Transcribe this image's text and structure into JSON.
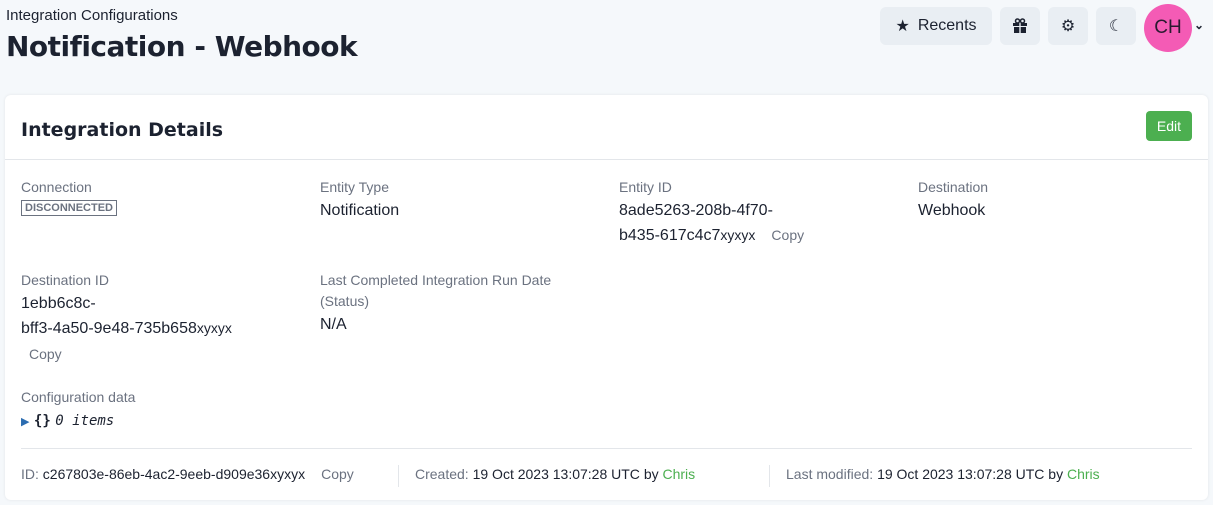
{
  "header": {
    "breadcrumb": "Integration Configurations",
    "title": "Notification - Webhook",
    "recents": "Recents",
    "avatar": "CH"
  },
  "card": {
    "title": "Integration Details",
    "edit": "Edit",
    "connection": {
      "label": "Connection",
      "value": "DISCONNECTED"
    },
    "entity_type": {
      "label": "Entity Type",
      "value": "Notification"
    },
    "entity_id": {
      "label": "Entity ID",
      "line1": "8ade5263-208b-4f70-",
      "line2": "b435-617c4c7",
      "suffix": "xyxyx",
      "copy": "Copy"
    },
    "destination": {
      "label": "Destination",
      "value": "Webhook"
    },
    "destination_id": {
      "label": "Destination ID",
      "line1": "1ebb6c8c-",
      "line2": "bff3-4a50-9e48-735b658",
      "suffix": "xyxyx",
      "copy": "Copy"
    },
    "last_run": {
      "label1": "Last Completed Integration Run Date",
      "label2": "(Status)",
      "value": "N/A"
    },
    "config": {
      "label": "Configuration data",
      "braces": "{}",
      "items": "0 items"
    },
    "footer": {
      "id_label": "ID:",
      "id": "c267803e-86eb-4ac2-9eeb-d909e36xyxyx",
      "copy": "Copy",
      "created_label": "Created:",
      "created": "19 Oct 2023 13:07:28 UTC",
      "by": "by",
      "created_by": "Chris",
      "modified_label": "Last modified:",
      "modified": "19 Oct 2023 13:07:28 UTC",
      "modified_by": "Chris"
    }
  }
}
